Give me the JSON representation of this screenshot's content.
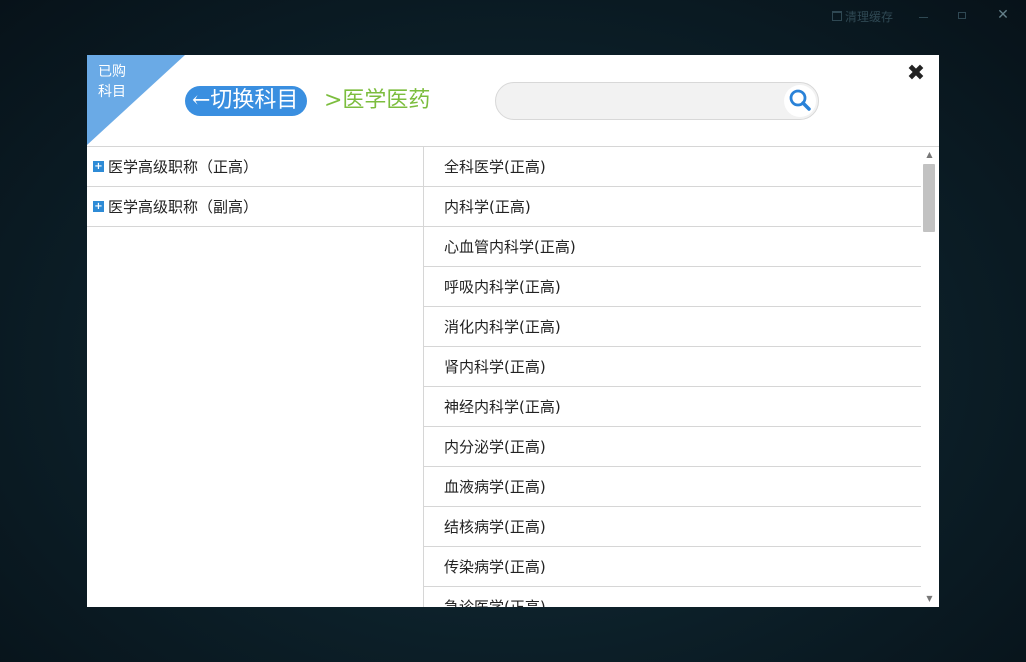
{
  "window": {
    "clear_cache_label": "清理缓存",
    "close_glyph": "✕"
  },
  "dialog": {
    "corner_badge": "已购科目",
    "switch_label": "←切换科目",
    "breadcrumb": ">医学医药",
    "search": {
      "value": "",
      "placeholder": ""
    },
    "close_glyph": "✖"
  },
  "categories": [
    {
      "label": "医学高级职称（正高）"
    },
    {
      "label": "医学高级职称（副高）"
    }
  ],
  "subjects": [
    {
      "label": "全科医学(正高)"
    },
    {
      "label": "内科学(正高)"
    },
    {
      "label": "心血管内科学(正高)"
    },
    {
      "label": "呼吸内科学(正高)"
    },
    {
      "label": "消化内科学(正高)"
    },
    {
      "label": "肾内科学(正高)"
    },
    {
      "label": "神经内科学(正高)"
    },
    {
      "label": "内分泌学(正高)"
    },
    {
      "label": "血液病学(正高)"
    },
    {
      "label": "结核病学(正高)"
    },
    {
      "label": "传染病学(正高)"
    },
    {
      "label": "急诊医学(正高)"
    }
  ],
  "scrollbar": {
    "position_fraction": 0.0
  }
}
